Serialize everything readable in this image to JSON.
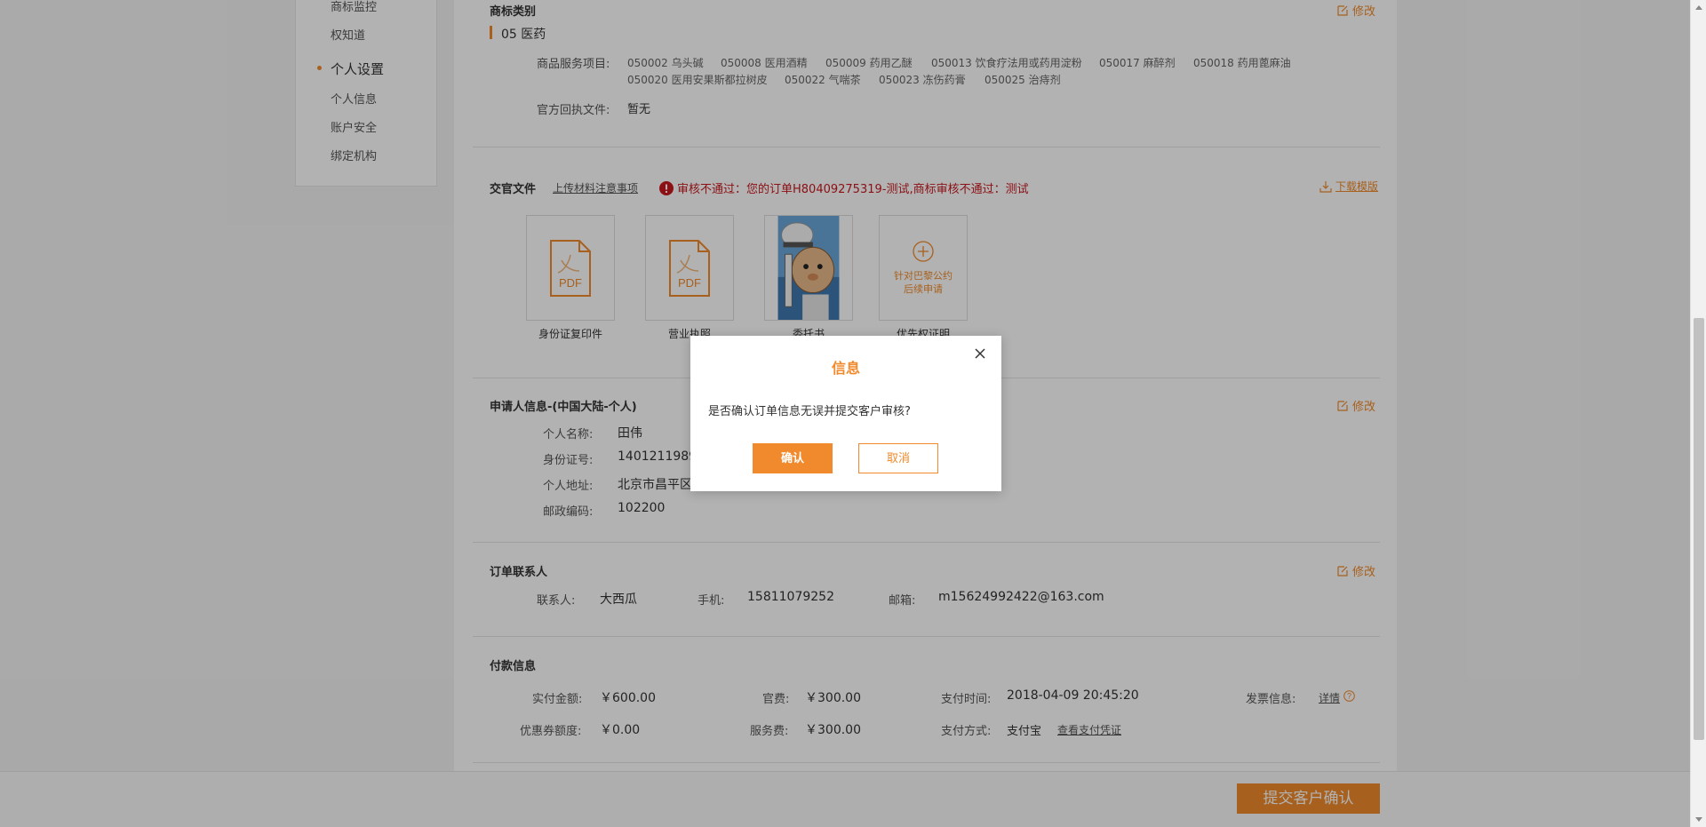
{
  "sidebar": {
    "items_top": [
      "商标监控",
      "权知道"
    ],
    "group_label": "个人设置",
    "items": [
      "个人信息",
      "账户安全",
      "绑定机构"
    ]
  },
  "trademark": {
    "title": "商标类别",
    "edit_label": "修改",
    "category": "05 医药",
    "services_label": "商品服务项目:",
    "services_row1": [
      "050002 乌头碱",
      "050008 医用酒精",
      "050009 药用乙醚",
      "050013 饮食疗法用或药用淀粉",
      "050017 麻醉剂",
      "050018 药用蓖麻油"
    ],
    "services_row2": [
      "050020 医用安果斯都拉树皮",
      "050022 气喘茶",
      "050023 冻伤药膏",
      "050025 治痔剂"
    ],
    "official_label": "官方回执文件:",
    "official_value": "暂无"
  },
  "documents": {
    "title": "交官文件",
    "upload_notes": "上传材料注意事项",
    "error_text": "审核不通过：您的订单H80409275319-测试,商标审核不通过：测试",
    "download_template": "下载模版",
    "items": [
      {
        "caption": "身份证复印件",
        "badge": "PDF"
      },
      {
        "caption": "营业执照",
        "badge": "PDF"
      },
      {
        "caption": "委托书"
      },
      {
        "caption": "优先权证明",
        "add_text_1": "针对巴黎公约",
        "add_text_2": "后续申请"
      }
    ]
  },
  "applicant": {
    "title": "申请人信息-(中国大陆-个人)",
    "edit_label": "修改",
    "name_label": "个人名称:",
    "name_value": "田伟",
    "id_label": "身份证号:",
    "id_value": "14012119893",
    "address_label": "个人地址:",
    "address_value": "北京市昌平区",
    "zip_label": "邮政编码:",
    "zip_value": "102200"
  },
  "contact": {
    "title": "订单联系人",
    "edit_label": "修改",
    "person_label": "联系人:",
    "person_value": "大西瓜",
    "phone_label": "手机:",
    "phone_value": "15811079252",
    "email_label": "邮箱:",
    "email_value": "m15624992422@163.com"
  },
  "payment": {
    "title": "付款信息",
    "paid_label": "实付金额:",
    "paid_value": "￥600.00",
    "official_fee_label": "官费:",
    "official_fee_value": "￥300.00",
    "pay_time_label": "支付时间:",
    "pay_time_value": "2018-04-09 20:45:20",
    "invoice_label": "发票信息:",
    "invoice_link": "详情",
    "coupon_label": "优惠券额度:",
    "coupon_value": "￥0.00",
    "service_fee_label": "服务费:",
    "service_fee_value": "￥300.00",
    "pay_method_label": "支付方式:",
    "pay_method_value": "支付宝",
    "view_voucher": "查看支付凭证"
  },
  "bottom": {
    "submit_label": "提交客户确认"
  },
  "dialog": {
    "title": "信息",
    "message": "是否确认订单信息无误并提交客户审核?",
    "ok_label": "确认",
    "cancel_label": "取消"
  },
  "colors": {
    "accent": "#f08a2c",
    "error": "#c9181e"
  }
}
